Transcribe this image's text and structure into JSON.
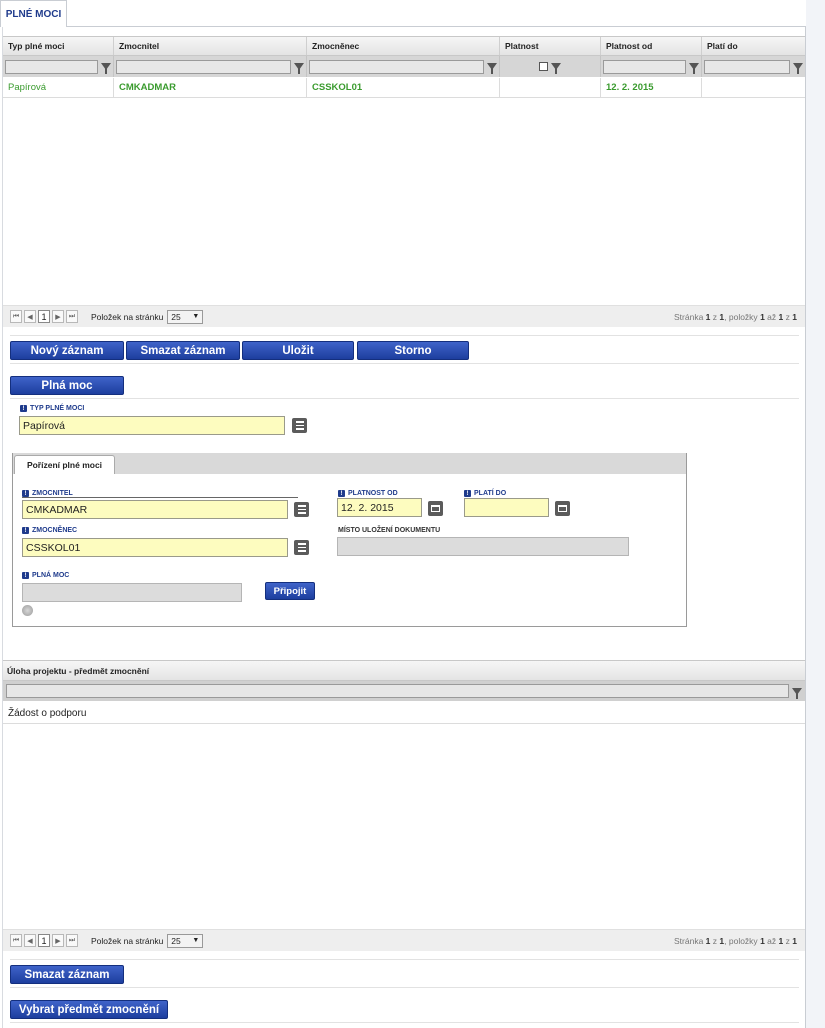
{
  "top_tab": "PLNÉ MOCI",
  "grid1": {
    "columns": [
      "Typ plné moci",
      "Zmocnitel",
      "Zmocněnec",
      "Platnost",
      "Platnost od",
      "Platí do"
    ],
    "rows": [
      [
        "Papírová",
        "CMKADMAR",
        "CSSKOL01",
        "",
        "12. 2. 2015",
        ""
      ]
    ]
  },
  "pager1": {
    "first": "⏮",
    "prev": "◀",
    "page": "1",
    "next": "▶",
    "last": "⏭",
    "per_page_label": "Položek na stránku",
    "per_page": "25",
    "info_prefix": "Stránka",
    "info_page": "1",
    "info_of": "z",
    "info_pages": "1",
    "info_items_label": ", položky",
    "info_from": "1",
    "info_to_label": "až",
    "info_to": "1",
    "info_total_of": "z",
    "info_total": "1"
  },
  "actions": {
    "new": "Nový záznam",
    "delete": "Smazat záznam",
    "save": "Uložit",
    "cancel": "Storno"
  },
  "section_button": "Plná moc",
  "form": {
    "typ_label": "TYP PLNÉ MOCI",
    "typ_value": "Papírová",
    "subtab": "Pořízení plné moci",
    "zmocnitel_label": "ZMOCNITEL",
    "zmocnitel_value": "CMKADMAR",
    "zmocnenec_label": "ZMOCNĚNEC",
    "zmocnenec_value": "CSSKOL01",
    "platnost_od_label": "PLATNOST OD",
    "platnost_od_value": "12. 2. 2015",
    "plati_do_label": "PLATÍ DO",
    "plati_do_value": "",
    "misto_label": "MÍSTO ULOŽENÍ DOKUMENTU",
    "plna_moc_label": "PLNÁ MOC",
    "pripojit": "Připojit",
    "req_mark": "!"
  },
  "grid2": {
    "column": "Úloha projektu - předmět zmocnění",
    "rows": [
      "Žádost o podporu"
    ]
  },
  "pager2": {
    "first": "⏮",
    "prev": "◀",
    "page": "1",
    "next": "▶",
    "last": "⏭",
    "per_page_label": "Položek na stránku",
    "per_page": "25",
    "info_prefix": "Stránka",
    "info_page": "1",
    "info_of": "z",
    "info_pages": "1",
    "info_items_label": ", položky",
    "info_from": "1",
    "info_to_label": "až",
    "info_to": "1",
    "info_total_of": "z",
    "info_total": "1"
  },
  "bottom": {
    "delete": "Smazat záznam",
    "choose": "Vybrat předmět zmocnění"
  }
}
